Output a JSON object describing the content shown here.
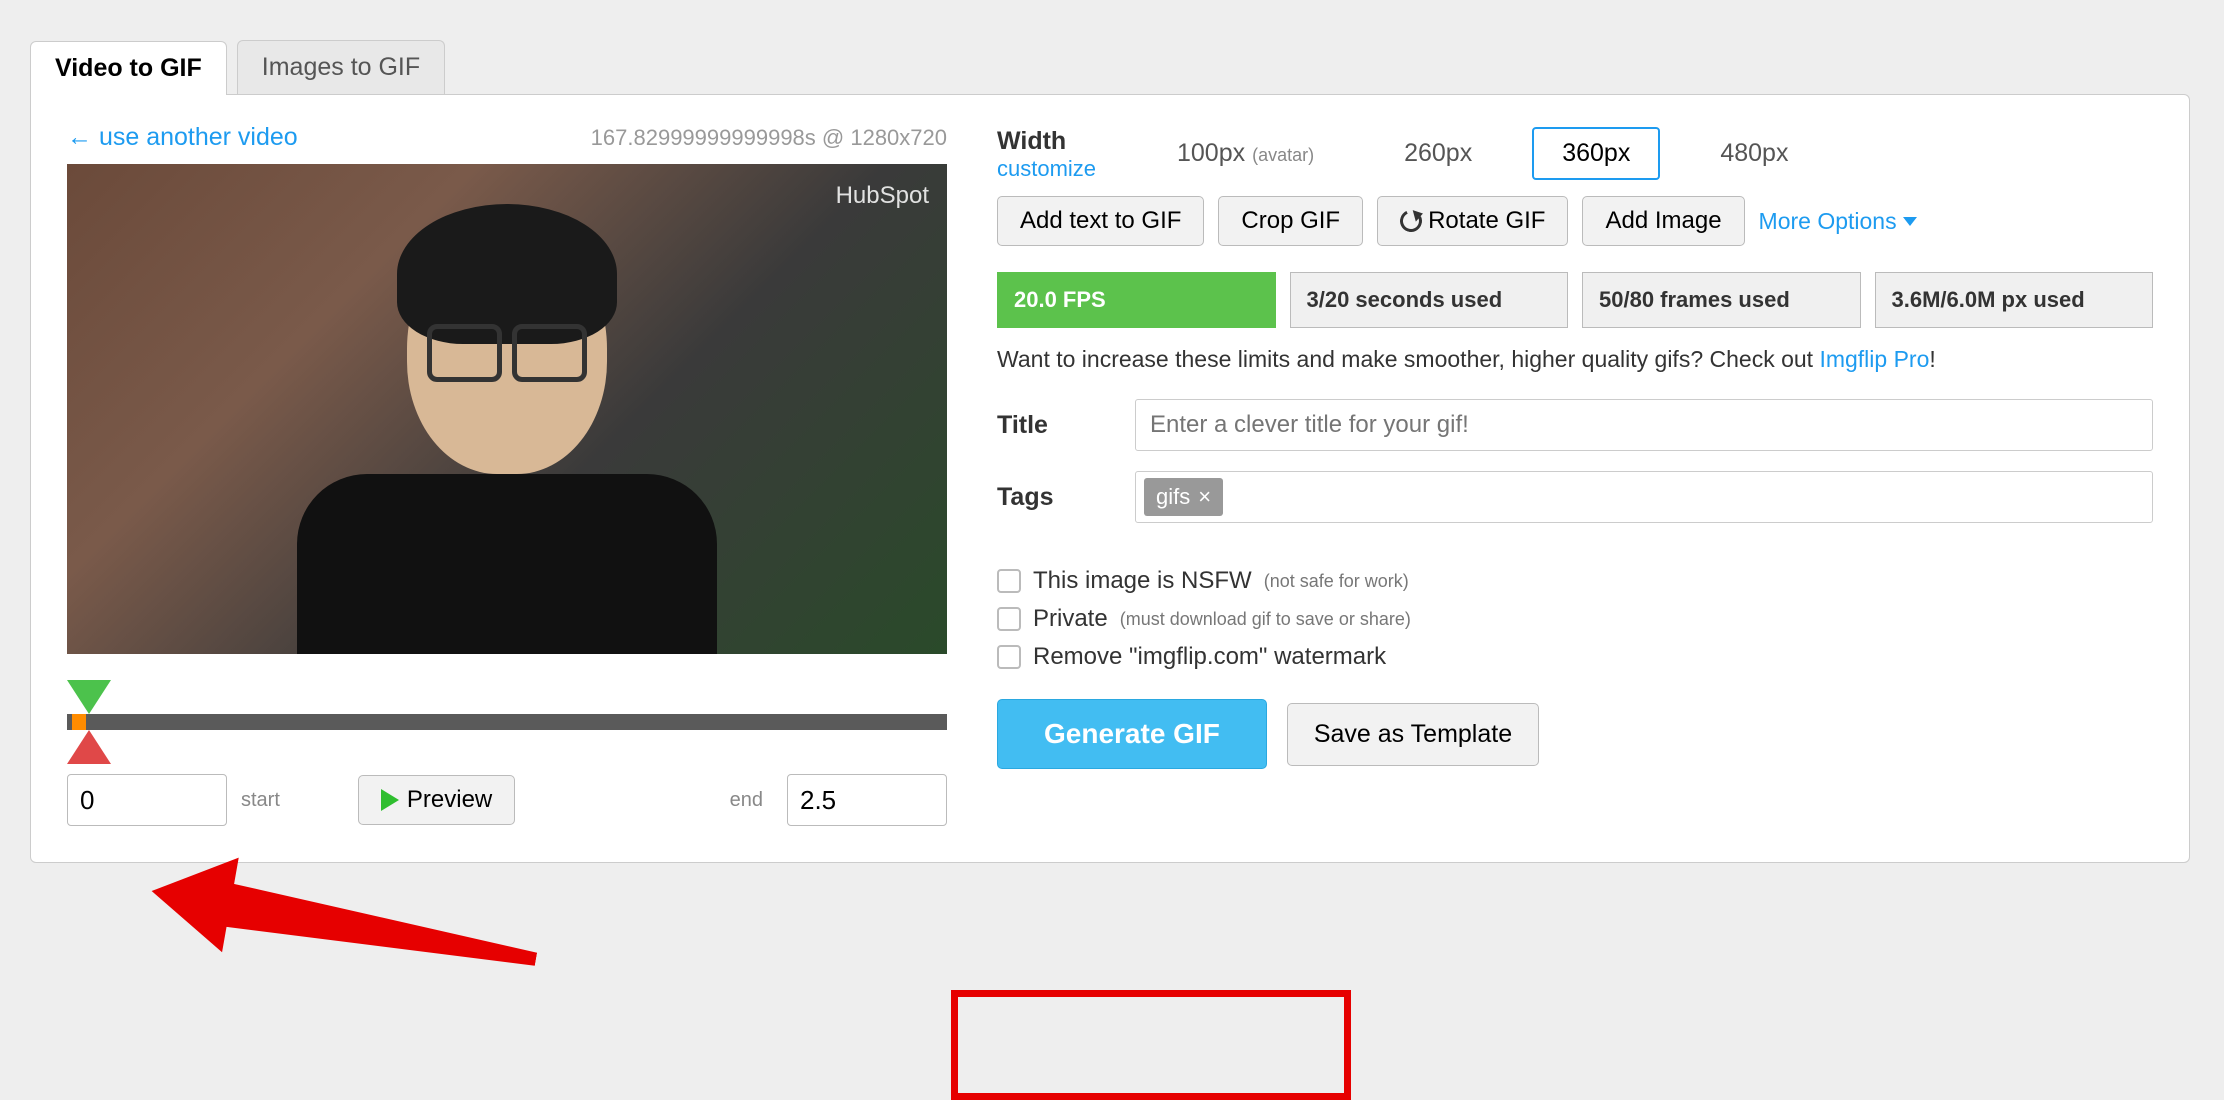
{
  "tabs": {
    "video_to_gif": "Video to GIF",
    "images_to_gif": "Images to GIF"
  },
  "left": {
    "use_another": "← use another video",
    "video_meta": "167.82999999999998s @ 1280x720",
    "watermark": "HubSpot",
    "start_value": "0",
    "start_label": "start",
    "preview_label": "Preview",
    "end_label": "end",
    "end_value": "2.5"
  },
  "width": {
    "label": "Width",
    "customize": "customize",
    "options": [
      {
        "label": "100px",
        "note": "(avatar)"
      },
      {
        "label": "260px",
        "note": ""
      },
      {
        "label": "360px",
        "note": ""
      },
      {
        "label": "480px",
        "note": ""
      }
    ]
  },
  "toolbuttons": {
    "add_text": "Add text to GIF",
    "crop": "Crop GIF",
    "rotate": "Rotate GIF",
    "add_image": "Add Image",
    "more": "More Options"
  },
  "stats": {
    "fps": "20.0 FPS",
    "seconds": "3/20 seconds used",
    "frames": "50/80 frames used",
    "px": "3.6M/6.0M px used"
  },
  "limits_line": {
    "prefix": "Want to increase these limits and make smoother, higher quality gifs? Check out ",
    "link": "Imgflip Pro",
    "suffix": "!"
  },
  "title": {
    "label": "Title",
    "placeholder": "Enter a clever title for your gif!"
  },
  "tags": {
    "label": "Tags",
    "chip": "gifs"
  },
  "checkboxes": {
    "nsfw_label": "This image is NSFW",
    "nsfw_note": "(not safe for work)",
    "private_label": "Private",
    "private_note": "(must download gif to save or share)",
    "remove_wm": "Remove \"imgflip.com\" watermark"
  },
  "actions": {
    "generate": "Generate GIF",
    "save_template": "Save as Template"
  }
}
